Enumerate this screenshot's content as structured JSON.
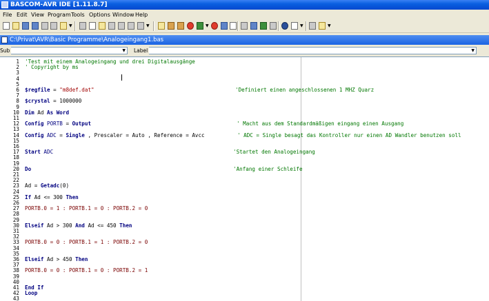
{
  "window": {
    "title": "BASCOM-AVR IDE [1.11.8.7]"
  },
  "menu": [
    "File",
    "Edit",
    "View",
    "Program",
    "Tools",
    "Options",
    "Window",
    "Help"
  ],
  "document": {
    "title": "C:\\Privat\\AVR\\Basic Programme\\Analogeingang1.bas"
  },
  "sub_bar": {
    "sub_label": "Sub",
    "label_label": "Label"
  },
  "editor": {
    "lines": [
      {
        "n": "1",
        "parts": [
          {
            "c": "cmt",
            "t": "'Test mit einem Analogeingang und drei Digitalausgänge"
          }
        ]
      },
      {
        "n": "2",
        "parts": [
          {
            "c": "cmt",
            "t": "' Copyright by ms"
          }
        ]
      },
      {
        "n": "3",
        "parts": []
      },
      {
        "n": "4",
        "parts": []
      },
      {
        "n": "5",
        "parts": []
      },
      {
        "n": "6",
        "parts": [
          {
            "c": "kw",
            "t": "$regfile"
          },
          {
            "c": "op",
            "t": " = "
          },
          {
            "c": "str",
            "t": "\"m8def.dat\""
          }
        ],
        "comment": "'Definiert einen angeschlossenen 1 MHZ Quarz"
      },
      {
        "n": "7",
        "parts": []
      },
      {
        "n": "8",
        "parts": [
          {
            "c": "kw",
            "t": "$crystal"
          },
          {
            "c": "op",
            "t": " = 1000000"
          }
        ]
      },
      {
        "n": "9",
        "parts": []
      },
      {
        "n": "10",
        "parts": [
          {
            "c": "kw",
            "t": "Dim"
          },
          {
            "c": "op",
            "t": " Ad "
          },
          {
            "c": "kw",
            "t": "As Word"
          }
        ]
      },
      {
        "n": "11",
        "parts": []
      },
      {
        "n": "12",
        "parts": [
          {
            "c": "kw",
            "t": "Config"
          },
          {
            "c": "id",
            "t": " PORTB"
          },
          {
            "c": "op",
            "t": " = "
          },
          {
            "c": "kw",
            "t": "Output"
          }
        ],
        "comment": "' Macht aus dem Standardmäßigen eingang einen Ausgang"
      },
      {
        "n": "13",
        "parts": []
      },
      {
        "n": "14",
        "parts": [
          {
            "c": "kw",
            "t": "Config"
          },
          {
            "c": "id",
            "t": " ADC"
          },
          {
            "c": "op",
            "t": " = "
          },
          {
            "c": "kw",
            "t": "Single"
          },
          {
            "c": "op",
            "t": " , Prescaler = Auto , Reference = Avcc"
          }
        ],
        "comment": "' ADC = Single besagt das Kontroller nur einen AD Wandler benutzen soll"
      },
      {
        "n": "15",
        "parts": []
      },
      {
        "n": "16",
        "parts": []
      },
      {
        "n": "17",
        "parts": [
          {
            "c": "kw",
            "t": "Start"
          },
          {
            "c": "id",
            "t": " ADC"
          }
        ],
        "comment": "'Startet den Analogeingang"
      },
      {
        "n": "18",
        "parts": []
      },
      {
        "n": "19",
        "parts": []
      },
      {
        "n": "20",
        "parts": [
          {
            "c": "kw",
            "t": "Do"
          }
        ],
        "comment": "'Anfang einer Schleife"
      },
      {
        "n": "21",
        "parts": []
      },
      {
        "n": "22",
        "parts": []
      },
      {
        "n": "23",
        "parts": [
          {
            "c": "op",
            "t": "Ad = "
          },
          {
            "c": "kw",
            "t": "Getadc"
          },
          {
            "c": "op",
            "t": "(0)"
          }
        ]
      },
      {
        "n": "24",
        "parts": []
      },
      {
        "n": "25",
        "parts": [
          {
            "c": "kw",
            "t": "If"
          },
          {
            "c": "op",
            "t": " Ad <= 300 "
          },
          {
            "c": "kw",
            "t": "Then"
          }
        ]
      },
      {
        "n": "26",
        "parts": []
      },
      {
        "n": "27",
        "parts": [
          {
            "c": "reg",
            "t": "PORTB.0 = 1 : PORTB.1 = 0 : PORTB.2 = 0"
          }
        ]
      },
      {
        "n": "28",
        "parts": []
      },
      {
        "n": "29",
        "parts": []
      },
      {
        "n": "30",
        "parts": [
          {
            "c": "kw",
            "t": "Elseif"
          },
          {
            "c": "op",
            "t": " Ad > 300 "
          },
          {
            "c": "kw",
            "t": "And"
          },
          {
            "c": "op",
            "t": " Ad <= 450 "
          },
          {
            "c": "kw",
            "t": "Then"
          }
        ]
      },
      {
        "n": "31",
        "parts": []
      },
      {
        "n": "32",
        "parts": []
      },
      {
        "n": "33",
        "parts": [
          {
            "c": "reg",
            "t": "PORTB.0 = 0 : PORTB.1 = 1 : PORTB.2 = 0"
          }
        ]
      },
      {
        "n": "34",
        "parts": []
      },
      {
        "n": "35",
        "parts": []
      },
      {
        "n": "36",
        "parts": [
          {
            "c": "kw",
            "t": "Elseif"
          },
          {
            "c": "op",
            "t": " Ad > 450 "
          },
          {
            "c": "kw",
            "t": "Then"
          }
        ]
      },
      {
        "n": "37",
        "parts": []
      },
      {
        "n": "38",
        "parts": [
          {
            "c": "reg",
            "t": "PORTB.0 = 0 : PORTB.1 = 0 : PORTB.2 = 1"
          }
        ]
      },
      {
        "n": "39",
        "parts": []
      },
      {
        "n": "40",
        "parts": []
      },
      {
        "n": "41",
        "parts": [
          {
            "c": "kw",
            "t": "End If"
          }
        ]
      },
      {
        "n": "42",
        "parts": [
          {
            "c": "kw",
            "t": "Loop"
          }
        ]
      },
      {
        "n": "43",
        "parts": []
      }
    ]
  }
}
